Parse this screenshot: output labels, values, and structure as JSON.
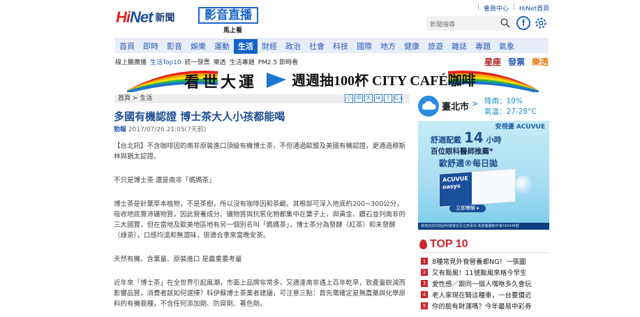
{
  "header": {
    "logo_text": "HiNet",
    "logo_suffix": "新聞",
    "live_label": "影音直播",
    "live_sub": "馬上看",
    "top_links": [
      "會員中心",
      "HiNet首頁"
    ],
    "search_placeholder": "新聞搜尋"
  },
  "nav": {
    "items": [
      "首頁",
      "即時",
      "影音",
      "娛樂",
      "運動",
      "生活",
      "財經",
      "政治",
      "社會",
      "科技",
      "國際",
      "地方",
      "健康",
      "旅遊",
      "雜誌",
      "專題",
      "氣象"
    ],
    "active": "生活"
  },
  "subbar": {
    "items": [
      "線上聽廣播",
      "生活Top10",
      "統一發票",
      "樂透",
      "生活專題",
      "PM2.5 即時看"
    ],
    "right_links": [
      "星座",
      "發票",
      "樂透"
    ]
  },
  "banner": {
    "title": "看世大運",
    "promo": "週週抽100杯 CITY CAFÉ咖啡"
  },
  "breadcrumb": {
    "home": "首頁",
    "sep": ">",
    "section": "生活"
  },
  "share_icons": [
    "小",
    "中",
    "大",
    "✉",
    "f",
    "G+"
  ],
  "article": {
    "title": "多國有機認證 博士茶大人小孩都能喝",
    "source": "勁報",
    "datetime": "2017/07/26 21:05(7天前)",
    "paragraphs": [
      "【台北訊】不含咖啡因的南非原裝進口頂級有機博士茶，不但通過歐盟及美國有機認證，更通過穆斯林與猶太認證。",
      "不只是博士茶 還是南非「媽媽茶」",
      "博士茶是針葉草本植物，不是茶樹，所以沒有咖啡因和茶鹼。其根部可深入地底約200~300公分，吸收地底豐沛礦物質，因此營養成分、礦物質與抗氧化物都集中在葉子上，與黃金、鑽石並列南非的三大國寶，但在當地及歐美地區地有另一個別名叫「媽媽茶」，博士茶分為發酵（紅茶）和未發酵（綠茶），口感均溫和無澀味，很適合拿來當晚安茶。",
      "天然有機、含葉量、原裝進口 是最重要考量",
      "近年來「博士茶」在全世界引起風潮，市面上品牌非常多，又適逢南非遇上百年乾旱，致產量銳減而影響品質，消費者該如何選擇？科伊蘇博士茶業者建議，可注意三點：首先需確定是無農藥與化學原料的有機栽種，不含任何添加劑、防腐劑、著色劑。"
    ]
  },
  "weather": {
    "city": "臺北市",
    "rain": "降雨：10%",
    "temp": "氣溫：27-28°C"
  },
  "ad": {
    "brand": "安視優 ACUVUE",
    "line1": "舒適配戴",
    "hours": "14",
    "hours_unit": "小時",
    "line2": "百位眼科醫師推薦*",
    "line3": "歐舒適®每日拋",
    "product": "ACUVUE oasys",
    "cta": "立即瞭解 ▸",
    "fine": "使用前請詳閱說明書警語及注意事項 衛部醫器輸字第020448號"
  },
  "top10": {
    "title": "TOP 10",
    "items": [
      "8種常見外食營養都NG！一張圖",
      "又有颱風！11號颱風來格今早生",
      "愛性感／跟同一個人嘿咻多久會玩",
      "老人家現在騎這種車，一台要價近",
      "你的臉有財運嗎？今年最易中彩券"
    ]
  }
}
